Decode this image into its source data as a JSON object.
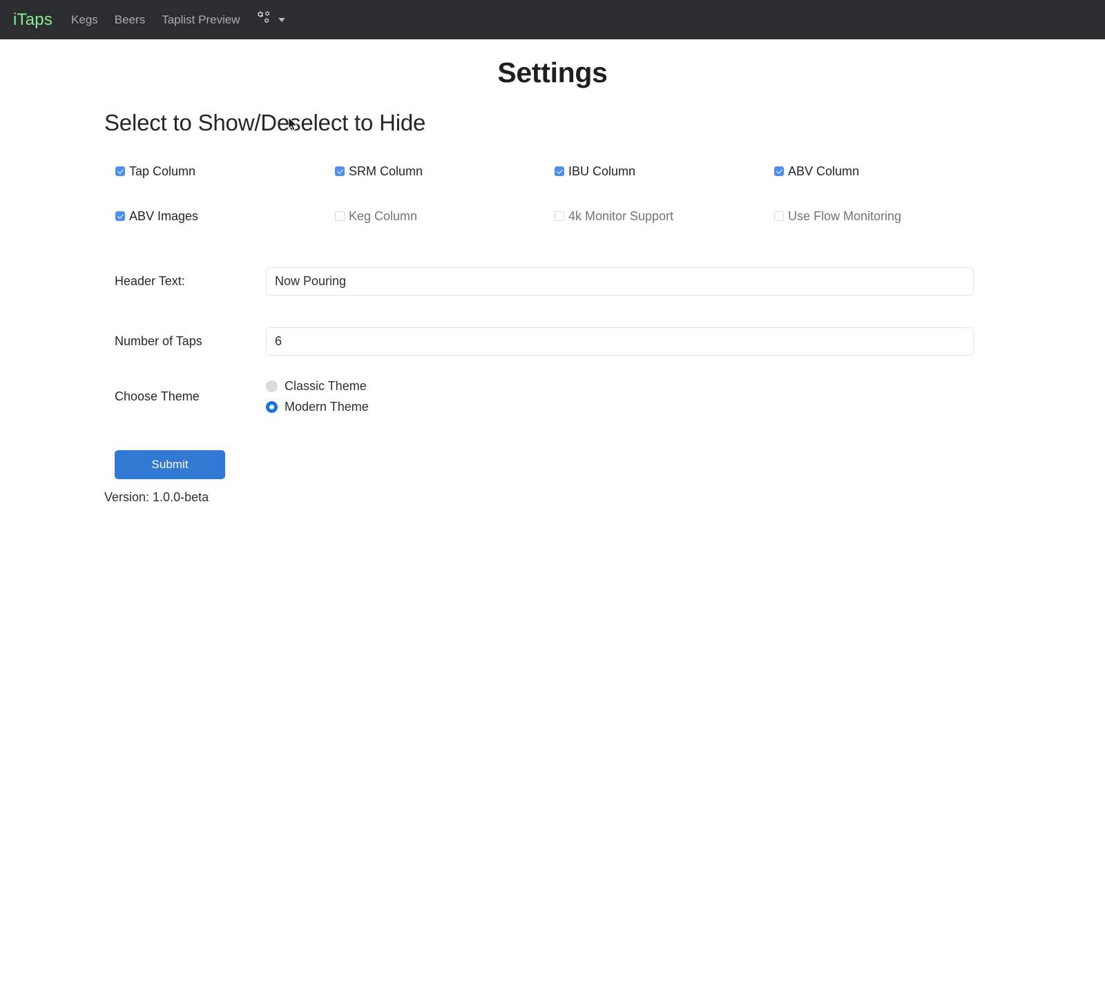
{
  "navbar": {
    "brand": "iTaps",
    "links": [
      {
        "label": "Kegs",
        "name": "nav-link-kegs"
      },
      {
        "label": "Beers",
        "name": "nav-link-beers"
      },
      {
        "label": "Taplist Preview",
        "name": "nav-link-taplist-preview"
      }
    ],
    "settings_icon": "cogs-icon",
    "dropdown_icon": "chevron-down-icon"
  },
  "page": {
    "title": "Settings",
    "subtitle": "Select to Show/Deselect to Hide"
  },
  "checkboxes": [
    {
      "label": "Tap Column",
      "checked": true
    },
    {
      "label": "SRM Column",
      "checked": true
    },
    {
      "label": "IBU Column",
      "checked": true
    },
    {
      "label": "ABV Column",
      "checked": true
    },
    {
      "label": "ABV Images",
      "checked": true
    },
    {
      "label": "Keg Column",
      "checked": false
    },
    {
      "label": "4k Monitor Support",
      "checked": false
    },
    {
      "label": "Use Flow Monitoring",
      "checked": false
    }
  ],
  "fields": [
    {
      "label": "Header Text:",
      "value": "Now Pouring",
      "placeholder": "Header Text"
    },
    {
      "label": "Number of Taps",
      "value": "6",
      "placeholder": "Number of Taps"
    }
  ],
  "theme": {
    "label": "Choose Theme",
    "options": [
      {
        "label": "Classic Theme",
        "selected": false
      },
      {
        "label": "Modern Theme",
        "selected": true
      }
    ]
  },
  "submit": {
    "label": "Submit"
  },
  "version": {
    "text": "Version: 1.0.0-beta"
  },
  "colors": {
    "navbar_bg": "#2b2d2f",
    "brand_green": "#8ce99a",
    "checkbox_blue": "#4d8ef0",
    "radio_blue": "#1775e0",
    "submit_blue": "#3279d4"
  }
}
